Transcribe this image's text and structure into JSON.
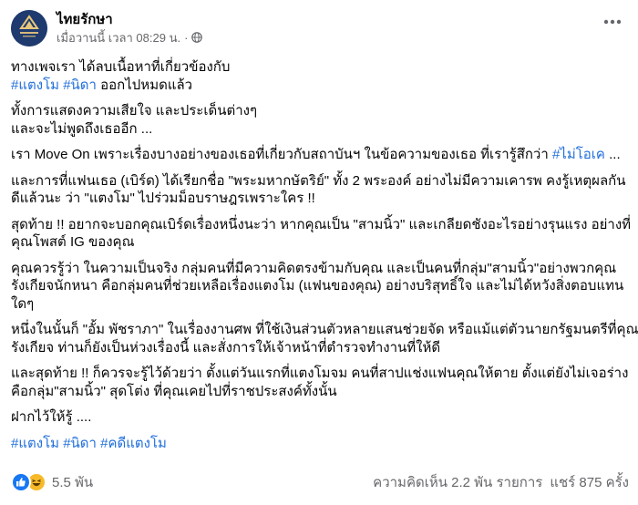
{
  "page": {
    "name": "ไทยรักษา",
    "timestamp": "เมื่อวานนี้ เวลา 08:29 น.",
    "separator": "·",
    "logo_text": "ไทยรักษา"
  },
  "post": {
    "paragraphs": [
      [
        [
          {
            "t": "ทางเพจเรา ได้ลบเนื้อหาที่เกี่ยวข้องกับ"
          }
        ],
        [
          {
            "t": "#แตงโม",
            "tag": true
          },
          {
            "t": " "
          },
          {
            "t": "#นิดา",
            "tag": true
          },
          {
            "t": " ออกไปหมดแล้ว"
          }
        ]
      ],
      [
        [
          {
            "t": "ทั้งการแสดงความเสียใจ และประเด็นต่างๆ"
          }
        ],
        [
          {
            "t": "และจะไม่พูดถึงเธออีก ..."
          }
        ]
      ],
      [
        [
          {
            "t": "เรา Move On เพราะเรื่องบางอย่างของเธอที่เกี่ยวกับสถาบันฯ ในข้อความของเธอ ที่เรารู้สึกว่า "
          },
          {
            "t": "#ไม่โอเค",
            "tag": true
          },
          {
            "t": " ..."
          }
        ]
      ],
      [
        [
          {
            "t": "และการที่แฟนเธอ (เบิร์ด) ได้เรียกชื่อ \"พระมหากษัตริย์\" ทั้ง 2 พระองค์ อย่างไม่มีความเคารพ คงรู้เหตุผลกัน"
          }
        ],
        [
          {
            "t": "ดีแล้วนะ ว่า \"แตงโม\" ไปร่วมม็อบราษฎรเพราะใคร !!"
          }
        ]
      ],
      [
        [
          {
            "t": "สุดท้าย !! อยากจะบอกคุณเบิร์ดเรื่องหนึ่งนะว่า  หากคุณเป็น \"สามนิ้ว\" และเกลียดชังอะไรอย่างรุนแรง อย่างที่"
          }
        ],
        [
          {
            "t": "คุณโพสต์ IG ของคุณ"
          }
        ]
      ],
      [
        [
          {
            "t": "คุณควรรู้ว่า ในความเป็นจริง กลุ่มคนที่มีความคิดตรงข้ามกับคุณ และเป็นคนที่กลุ่ม\"สามนิ้ว\"อย่างพวกคุณ"
          }
        ],
        [
          {
            "t": "รังเกียจนักหนา คือกลุ่มคนที่ช่วยเหลือเรื่องแตงโม (แฟนของคุณ) อย่างบริสุทธิ์ใจ และไม่ได้หวังสิ่งตอบแทน"
          }
        ],
        [
          {
            "t": "ใดๆ"
          }
        ]
      ],
      [
        [
          {
            "t": "หนึ่งในนั้นก็ \"อั้ม พัชราภา\" ในเรื่องงานศพ ที่ใช้เงินส่วนตัวหลายแสนช่วยจัด หรือแม้แต่ตัวนายกรัฐมนตรีที่คุณ"
          }
        ],
        [
          {
            "t": "รังเกียจ ท่านก็ยังเป็นห่วงเรื่องนี้ และสั่งการให้เจ้าหน้าที่ตำรวจทำงานที่ให้ดี"
          }
        ]
      ],
      [
        [
          {
            "t": "และสุดท้าย !! ก็ควรจะรู้ไว้ด้วยว่า ตั้งแต่วันแรกที่แตงโมจม คนที่สาปแช่งแฟนคุณให้ตาย ตั้งแต่ยังไม่เจอร่าง"
          }
        ],
        [
          {
            "t": "คือกลุ่ม\"สามนิ้ว\" สุดโต่ง ที่คุณเคยไปที่ราชประสงค์ทั้งนั้น"
          }
        ]
      ],
      [
        [
          {
            "t": "ฝากไว้ให้รู้ ...."
          }
        ]
      ],
      [
        [
          {
            "t": "#แตงโม",
            "tag": true
          },
          {
            "t": " "
          },
          {
            "t": "#นิดา",
            "tag": true
          },
          {
            "t": " "
          },
          {
            "t": "#คดีแตงโม",
            "tag": true
          }
        ]
      ]
    ]
  },
  "footer": {
    "reaction_count": "5.5 พัน",
    "comments": "ความคิดเห็น 2.2 พัน รายการ",
    "shares": "แชร์ 875 ครั้ง"
  },
  "colors": {
    "link": "#216fdb",
    "secondary": "#65676b",
    "like": "#1877f2",
    "haha": "#f7b928"
  },
  "icons": [
    "globe-icon",
    "more-options-icon",
    "like-reaction-icon",
    "haha-reaction-icon"
  ]
}
